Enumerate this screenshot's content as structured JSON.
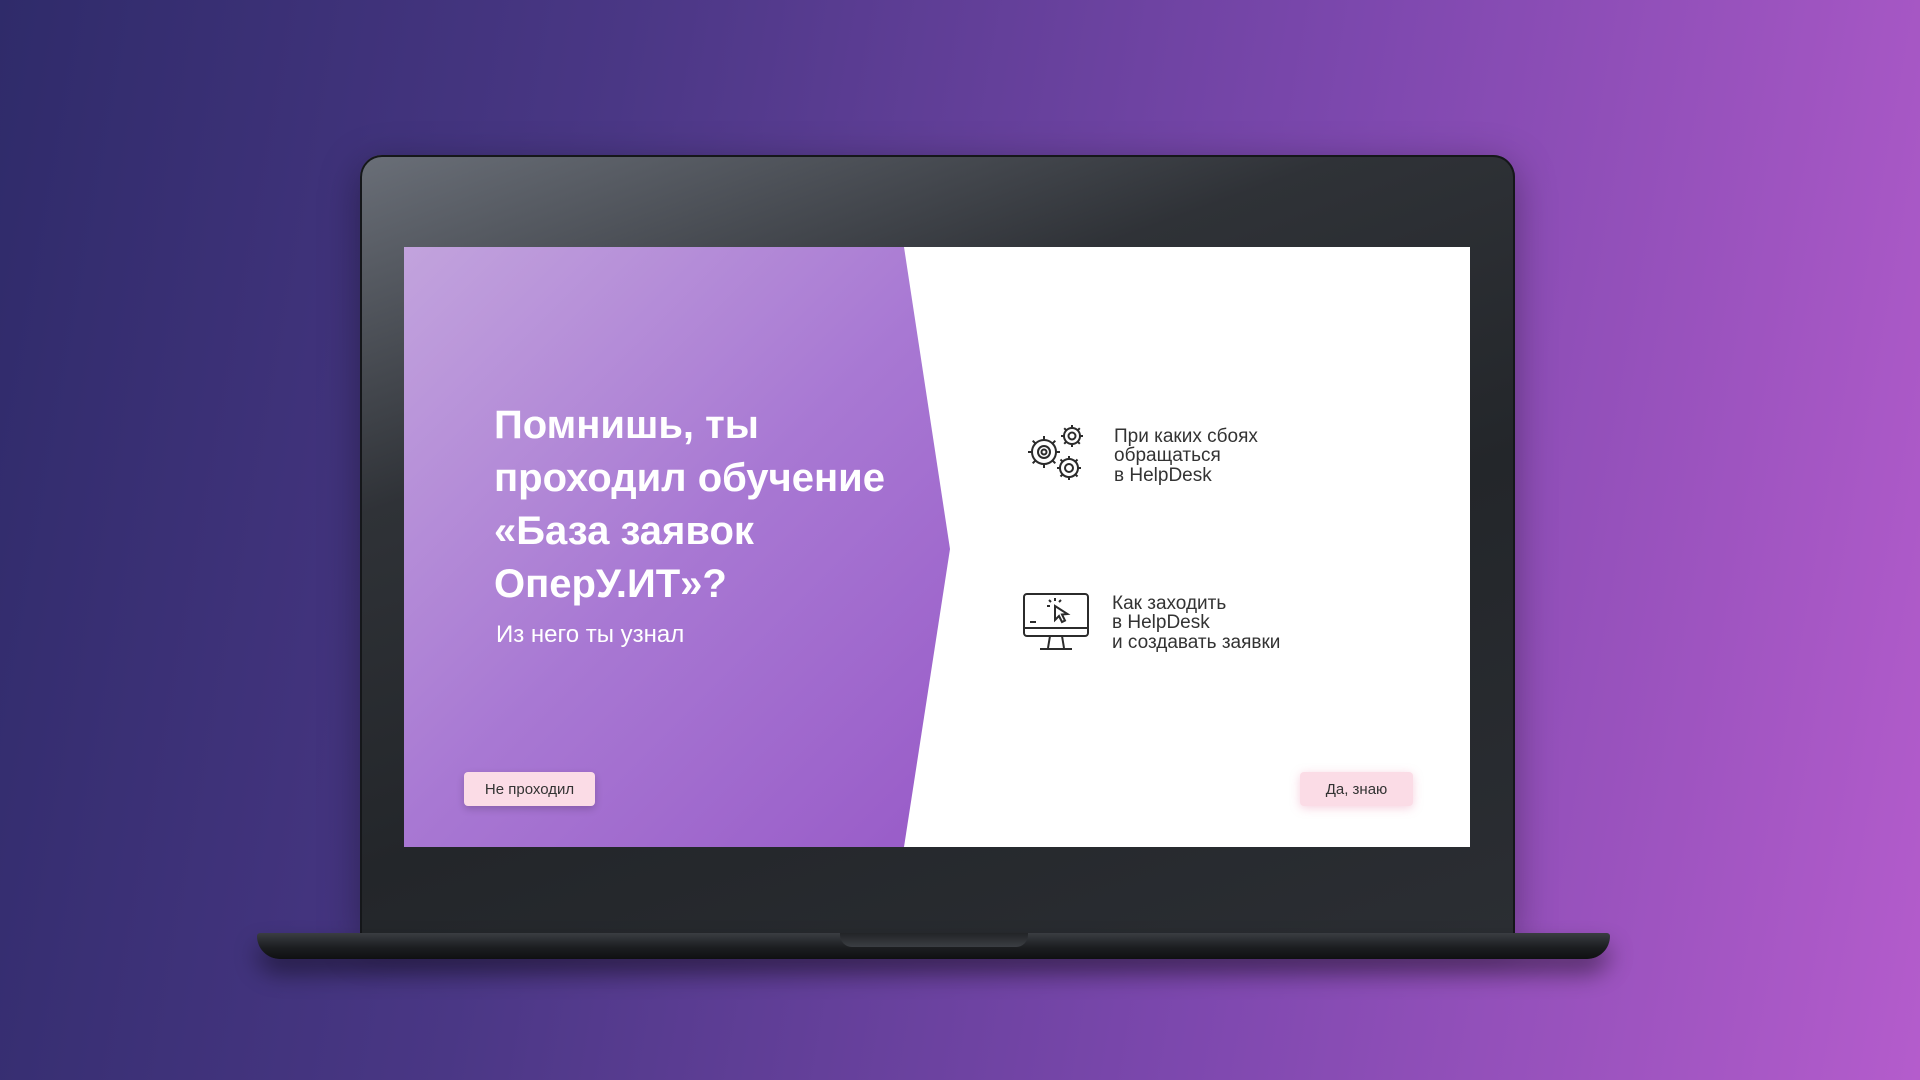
{
  "slide": {
    "title": "Помнишь, ты проходил обучение «База заявок ОперУ.ИТ»?",
    "subtitle": "Из него ты узнал",
    "items": [
      {
        "icon": "gears-icon",
        "text": "При каких сбоях\nобращаться\nв HelpDesk"
      },
      {
        "icon": "monitor-cursor-icon",
        "text": "Как заходить\nв HelpDesk\nи создавать заявки"
      }
    ],
    "buttons": {
      "no_label": "Не проходил",
      "yes_label": "Да, знаю"
    }
  },
  "colors": {
    "background_start": "#2f2b6a",
    "background_end": "#b45ccc",
    "panel_purple": "#9a5ec9",
    "button_pink": "#fbdce6"
  }
}
